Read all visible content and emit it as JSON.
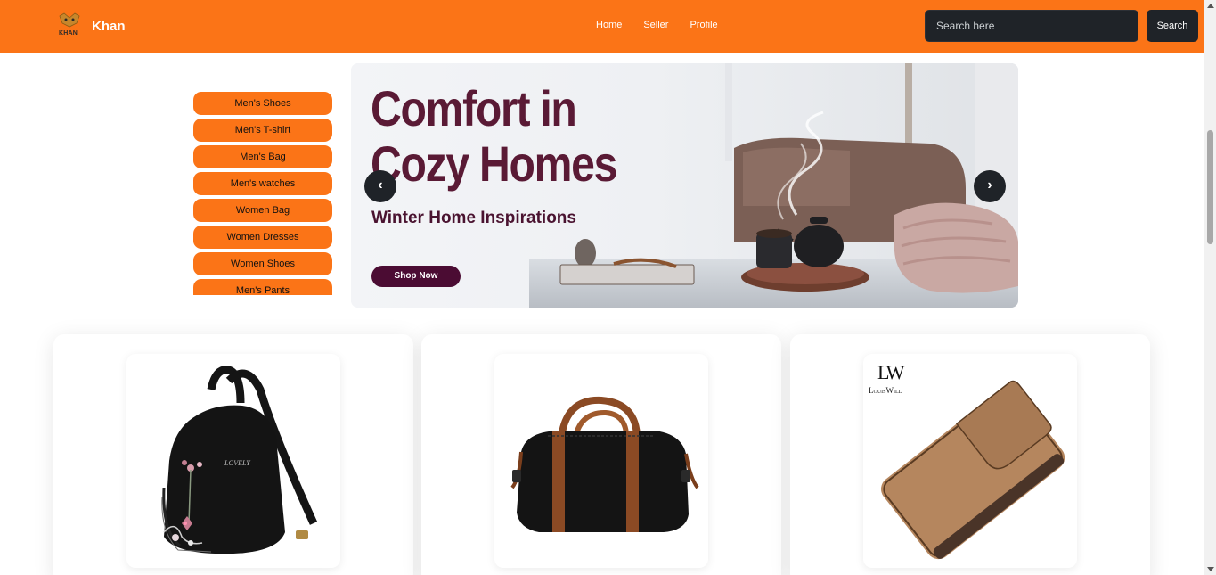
{
  "navbar": {
    "brand_logo_text": "KHAN",
    "brand_name": "Khan",
    "links": [
      {
        "label": "Home"
      },
      {
        "label": "Seller"
      },
      {
        "label": "Profile"
      }
    ],
    "search_placeholder": "Search here",
    "search_button": "Search",
    "colors": {
      "background": "#fb7417",
      "dark": "#1f2328"
    }
  },
  "categories": [
    {
      "label": "Men's Shoes"
    },
    {
      "label": "Men's T-shirt"
    },
    {
      "label": "Men's Bag"
    },
    {
      "label": "Men's watches"
    },
    {
      "label": "Women Bag"
    },
    {
      "label": "Women Dresses"
    },
    {
      "label": "Women Shoes"
    },
    {
      "label": "Men's Pants"
    }
  ],
  "carousel": {
    "title_line1": "Comfort in",
    "title_line2": "Cozy Homes",
    "subtitle": "Winter Home Inspirations",
    "cta": "Shop Now",
    "prev_icon": "chevron-left-icon",
    "next_icon": "chevron-right-icon",
    "prev_glyph": "‹",
    "next_glyph": "›"
  },
  "products": [
    {
      "image": "black-floral-backpack"
    },
    {
      "image": "black-duffel-bag-brown-straps"
    },
    {
      "image": "tan-leather-wallet",
      "brand_mark": "LW",
      "brand_text": "LouisWill"
    }
  ]
}
